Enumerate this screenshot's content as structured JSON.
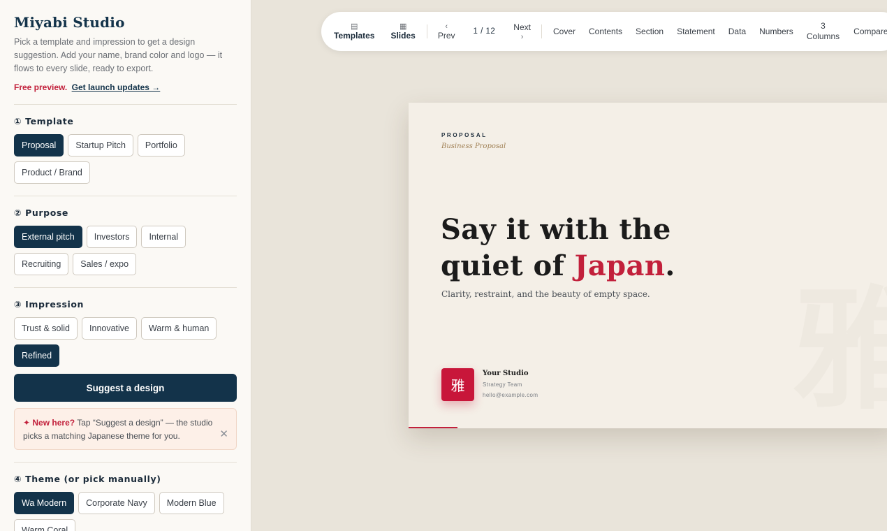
{
  "sidebar": {
    "brand": "Miyabi Studio",
    "intro": "Pick a template and impression to get a design suggestion. Add your name, brand color and logo — it flows to every slide, ready to export.",
    "preview_label": "Free preview.",
    "preview_link": "Get launch updates →",
    "template": {
      "title": "① Template",
      "options": [
        "Proposal",
        "Startup Pitch",
        "Portfolio",
        "Product / Brand"
      ],
      "selected": "Proposal"
    },
    "purpose": {
      "title": "② Purpose",
      "options": [
        "External pitch",
        "Investors",
        "Internal",
        "Recruiting",
        "Sales / expo"
      ],
      "selected": "External pitch"
    },
    "impression": {
      "title": "③ Impression",
      "options": [
        "Trust & solid",
        "Innovative",
        "Warm & human",
        "Refined"
      ],
      "selected": "Refined"
    },
    "suggest_label": "Suggest a design",
    "tip": {
      "lead": "✦ New here?",
      "text": "Tap “Suggest a design” — the studio picks a matching Japanese theme for you.",
      "close": "✕"
    },
    "theme": {
      "title": "④ Theme (or pick manually)",
      "options": [
        "Wa Modern",
        "Corporate Navy",
        "Modern Blue",
        "Warm Coral"
      ],
      "selected": "Wa Modern"
    }
  },
  "toolbar": {
    "templates_icon": "▤",
    "templates_label": "Templates",
    "slides_icon": "▦",
    "slides_label": "Slides",
    "prev_icon": "‹",
    "prev_label": "Prev",
    "page": "1 / 12",
    "next_label": "Next",
    "next_icon": "›",
    "slide_types": [
      "Cover",
      "Contents",
      "Section",
      "Statement",
      "Data",
      "Numbers"
    ],
    "columns_top": "3",
    "columns_bottom": "Columns",
    "compare_label": "Compare"
  },
  "slide": {
    "eyebrow": "PROPOSAL",
    "eyebrow_sub": "Business Proposal",
    "headline_line1": "Say it with the",
    "headline_line2_a": "quiet of ",
    "headline_accent": "Japan",
    "headline_end": ".",
    "subline": "Clarity, restraint, and the beauty of empty space.",
    "logo_glyph": "雅",
    "studio_name": "Your Studio",
    "studio_team": "Strategy Team",
    "studio_email": "hello@example.com",
    "accent_color": "#c2203b",
    "progress": 0.1
  }
}
